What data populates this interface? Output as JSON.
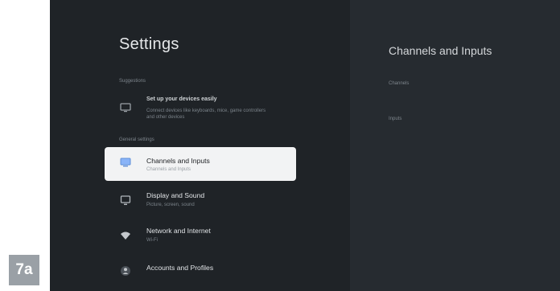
{
  "settings": {
    "title": "Settings",
    "section_suggestions": "Suggestions",
    "section_general": "General settings",
    "items": [
      {
        "label": "Set up your devices easily",
        "sub": "Connect devices like keyboards, mice, game controllers and other devices",
        "icon": "tv-remote-icon"
      },
      {
        "label": "Channels and Inputs",
        "sub": "Channels and Inputs",
        "icon": "tv-input-icon"
      },
      {
        "label": "Display and Sound",
        "sub": "Picture, screen, sound",
        "icon": "display-sound-icon"
      },
      {
        "label": "Network and Internet",
        "sub": "Wi-Fi",
        "icon": "wifi-icon"
      },
      {
        "label": "Accounts and Profiles",
        "sub": "",
        "icon": "account-icon"
      }
    ]
  },
  "detail": {
    "title": "Channels and Inputs",
    "items": [
      "Channels",
      "Inputs"
    ]
  },
  "badge": "7a",
  "colors": {
    "background": "#1f2327",
    "panel": "#262b30",
    "selected": "#f2f3f4",
    "badge": "#9aa0a6"
  }
}
